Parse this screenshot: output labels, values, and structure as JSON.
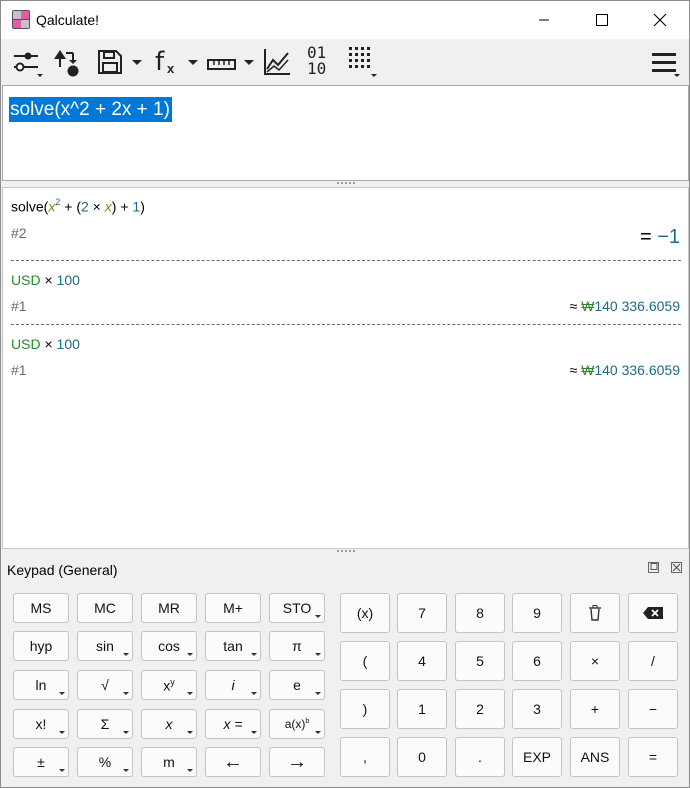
{
  "window": {
    "title": "Qalculate!"
  },
  "toolbar": {
    "items": [
      {
        "name": "mode-menu"
      },
      {
        "name": "store-variable"
      },
      {
        "name": "save-menu"
      },
      {
        "name": "functions-menu"
      },
      {
        "name": "units-menu"
      },
      {
        "name": "plot"
      },
      {
        "name": "number-bases"
      },
      {
        "name": "keypad-toggle"
      },
      {
        "name": "main-menu"
      }
    ],
    "bases_top": "01",
    "bases_bottom": "10",
    "fx_label": "f",
    "fx_sub": "x"
  },
  "expression": {
    "text": "solve(x^2 + 2x + 1)"
  },
  "history": {
    "entries": [
      {
        "expr_parts": {
          "fn": "solve(",
          "x1": "x",
          "sup2": "2",
          "plus1": " + (",
          "two": "2",
          "times": " × ",
          "x2": "x",
          "close1": ") + ",
          "one": "1",
          "close2": ")"
        },
        "ref": "#2",
        "result_prefix": "= ",
        "result": "−1"
      },
      {
        "expr_unit": "USD",
        "expr_rest": " × ",
        "expr_num": "100",
        "ref": "#1",
        "result_prefix": "≈ ",
        "result_unit": "₩",
        "result": "140 336.6059"
      },
      {
        "expr_unit": "USD",
        "expr_rest": " × ",
        "expr_num": "100",
        "ref": "#1",
        "result_prefix": "≈ ",
        "result_unit": "₩",
        "result": "140 336.6059"
      }
    ]
  },
  "keypad": {
    "title": "Keypad (General)",
    "left_rows": [
      [
        "MS",
        "MC",
        "MR",
        "M+",
        "STO"
      ],
      [
        "hyp",
        "sin",
        "cos",
        "tan",
        "π"
      ],
      [
        "ln",
        "√",
        "x",
        "i",
        "e"
      ],
      [
        "x!",
        "Σ",
        "x",
        "x =",
        "a(x)"
      ],
      [
        "±",
        "%",
        "m",
        "←",
        "→"
      ]
    ],
    "xy_sup": "y",
    "ax_sup": "b",
    "right_rows": [
      [
        "(x)",
        "7",
        "8",
        "9",
        "delete",
        "backspace"
      ],
      [
        "(",
        "4",
        "5",
        "6",
        "×",
        "/"
      ],
      [
        ")",
        "1",
        "2",
        "3",
        "+",
        "−"
      ],
      [
        ",",
        "0",
        ".",
        "EXP",
        "ANS",
        "="
      ]
    ]
  }
}
